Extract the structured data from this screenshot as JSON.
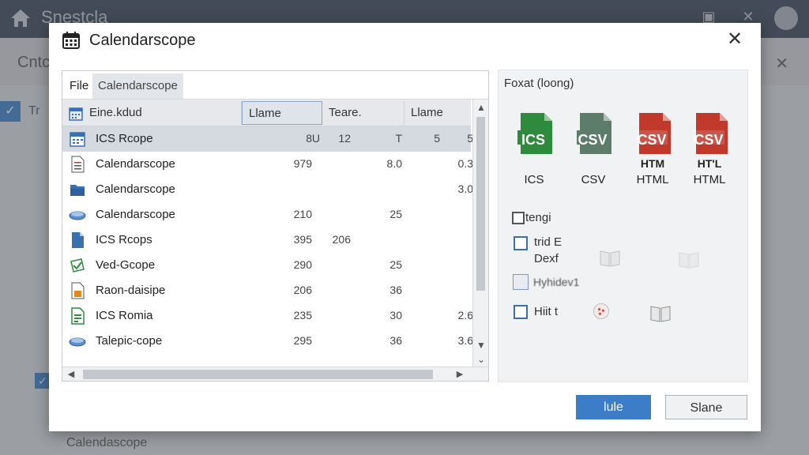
{
  "background": {
    "app_name": "Snestcla",
    "sub_title": "Cntc",
    "row_label_1": "Tr",
    "bottom_row_label": "Calendascope"
  },
  "dialog": {
    "title": "Calendarscope",
    "tabs": [
      "File",
      "Calendarscope"
    ],
    "columns": [
      "Eine.kdud",
      "Llame",
      "Teare.",
      "Llame"
    ],
    "rows": [
      {
        "icon": "calendar-icon",
        "name": "ICS Rcope",
        "v1": "8",
        "v2": "U",
        "v3": "12",
        "v4": "T",
        "v5": "5",
        "v6": "5",
        "selected": true
      },
      {
        "icon": "document-icon",
        "name": "Calendarscope",
        "v1": "979",
        "v2": "",
        "v3": "",
        "v4": "8.0",
        "v5": "",
        "v6": "0.3",
        "selected": false
      },
      {
        "icon": "folder-icon",
        "name": "Calendarscope",
        "v1": "",
        "v2": "",
        "v3": "",
        "v4": "",
        "v5": "",
        "v6": "3.0",
        "selected": false
      },
      {
        "icon": "drive-icon",
        "name": "Calendarscope",
        "v1": "210",
        "v2": "",
        "v3": "",
        "v4": "25",
        "v5": "",
        "v6": "",
        "selected": false
      },
      {
        "icon": "file-icon",
        "name": "ICS Rcops",
        "v1": "395",
        "v2": "",
        "v3": "206",
        "v4": "",
        "v5": "",
        "v6": "",
        "selected": false
      },
      {
        "icon": "spreadsheet-icon",
        "name": "Ved-Gcope",
        "v1": "290",
        "v2": "",
        "v3": "",
        "v4": "25",
        "v5": "",
        "v6": "",
        "selected": false
      },
      {
        "icon": "package-icon",
        "name": "Raon-daisipe",
        "v1": "206",
        "v2": "",
        "v3": "",
        "v4": "36",
        "v5": "",
        "v6": "",
        "selected": false
      },
      {
        "icon": "sheet-icon",
        "name": "ICS Romia",
        "v1": "235",
        "v2": "",
        "v3": "",
        "v4": "30",
        "v5": "",
        "v6": "2.6",
        "selected": false
      },
      {
        "icon": "drive-icon",
        "name": "Talepic-cope",
        "v1": "295",
        "v2": "",
        "v3": "",
        "v4": "36",
        "v5": "",
        "v6": "3.6",
        "selected": false
      }
    ],
    "format_title": "Foxat (loong)",
    "formats": [
      {
        "badge": "ICS",
        "label": "ICS",
        "color": "#2e8b3e"
      },
      {
        "badge": "CSV",
        "label": "CSV",
        "color": "#5d7d6a"
      },
      {
        "badge": "CSV",
        "sub": "HTM",
        "label": "HTML",
        "color": "#c0392b"
      },
      {
        "badge": "CSV",
        "sub": "HT'L",
        "label": "HTML",
        "color": "#c0392b"
      }
    ],
    "options": {
      "opt1": "tengi",
      "opt2_line1": "trid E",
      "opt2_line2": "Dexf",
      "field_text": "Hyhidev1",
      "opt3": "Hiit t"
    },
    "buttons": {
      "primary": "lule",
      "secondary": "Slane"
    }
  }
}
